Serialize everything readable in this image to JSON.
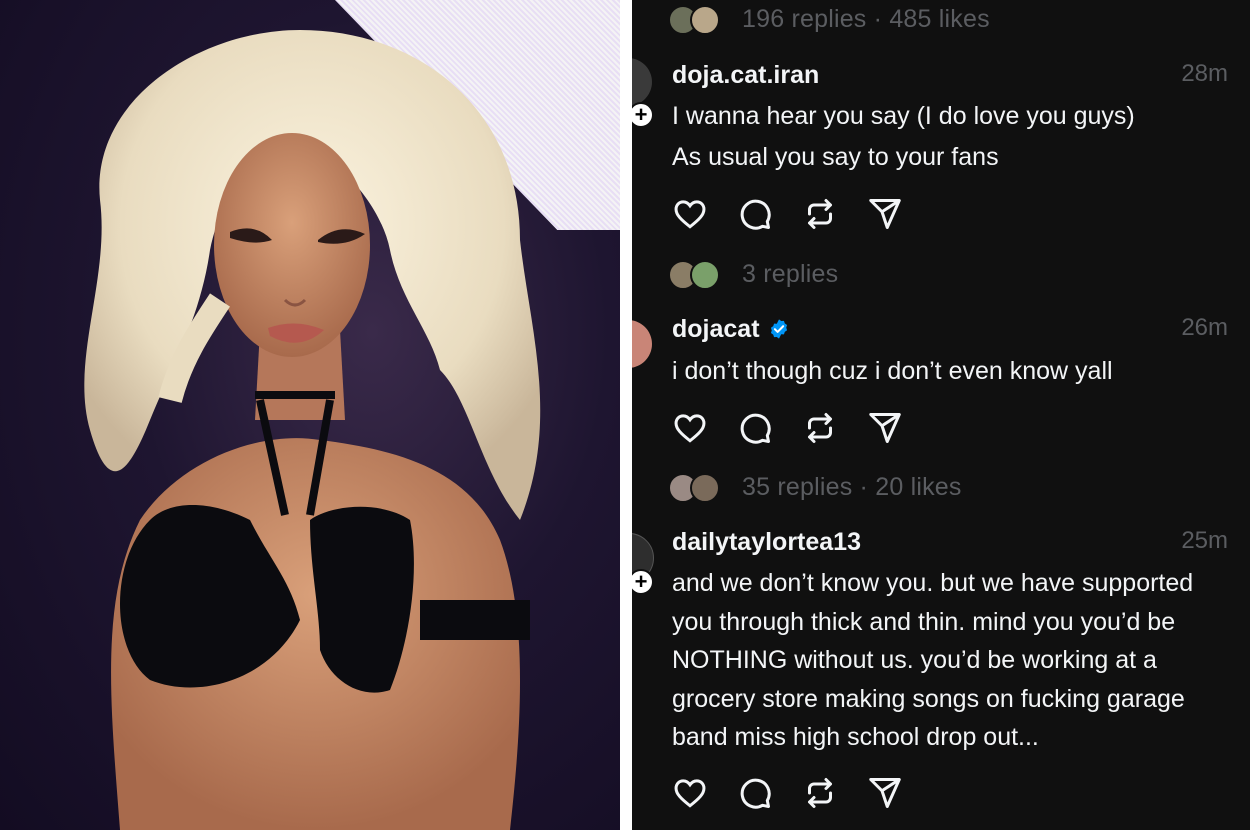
{
  "colors": {
    "thread_bg": "#101010",
    "text_primary": "#f3f5f7",
    "text_secondary": "#5b5d61",
    "verified": "#0095f6"
  },
  "top_stats": {
    "text": "196 replies · 485 likes"
  },
  "posts": [
    {
      "username": "doja.cat.iran",
      "time": "28m",
      "lines": [
        "I wanna hear you say (I do love you guys)",
        "As usual you say to your fans"
      ],
      "follow_icon": "+",
      "stats": "3 replies"
    },
    {
      "username": "dojacat",
      "verified": true,
      "time": "26m",
      "lines": [
        "i don’t though cuz i don’t even know yall"
      ],
      "stats": "35 replies · 20 likes"
    },
    {
      "username": "dailytaylortea13",
      "time": "25m",
      "lines": [
        "and we don’t know you. but we have supported",
        "you through thick and thin. mind you you’d be",
        "NOTHING without us. you’d be working at a",
        "grocery store making songs on fucking garage",
        "band miss high school drop out..."
      ],
      "follow_icon": "+"
    }
  ],
  "icons": [
    "heart-icon",
    "comment-icon",
    "repost-icon",
    "share-icon"
  ]
}
